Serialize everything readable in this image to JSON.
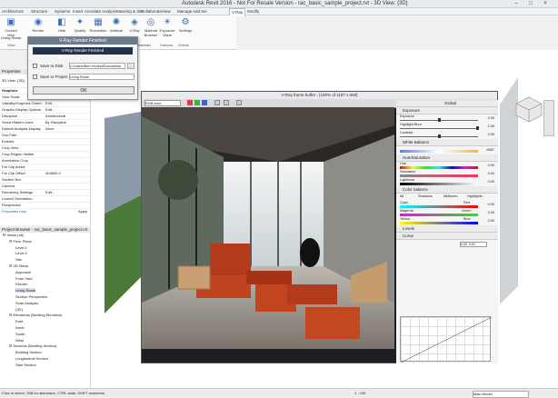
{
  "title": "Autodesk Revit 2016 - Not For Resale Version  -  rac_basic_sample_project.rvt - 3D View: {3D}",
  "tabs": [
    "Architecture",
    "Structure",
    "Systems",
    "Insert",
    "Annotate",
    "Analyze",
    "Massing & Site",
    "Collaborate",
    "View",
    "Manage",
    "Add-Ins",
    "V-Ray",
    "Modify"
  ],
  "active_tab": "V-Ray",
  "ribbon": {
    "buttons": [
      "Current View",
      "Render",
      "Hide",
      "Quality",
      "Resolution",
      "Artificial",
      "V-Ray",
      "Material Browser",
      "Exposure Value",
      "Settings"
    ],
    "panels": [
      "View",
      "Render",
      "Materials",
      "Camera",
      "Global"
    ],
    "view_value": "Living Room"
  },
  "dialog": {
    "title": "V-Ray Render Finished",
    "message": "V-Ray Render Finished",
    "save_to_disk": "Save to Disk",
    "save_to_disk_value": "C:\\Users\\Ben Hurlbut\\Documents",
    "save_to_project": "Save to Project",
    "save_to_project_value": "Living Room",
    "ok": "OK"
  },
  "properties": {
    "header": "Properties",
    "type": "3D View: {3D}",
    "edit_type": "Edit Type",
    "graphics": "Graphics",
    "rows": [
      {
        "k": "View Scale",
        "v": "1 : 100"
      },
      {
        "k": "Visibility/Graphics Overri...",
        "v": "Edit..."
      },
      {
        "k": "Graphic Display Options",
        "v": "Edit..."
      },
      {
        "k": "Discipline",
        "v": "Architectural"
      },
      {
        "k": "Show Hidden Lines",
        "v": "By Discipline"
      },
      {
        "k": "Default Analysis Display",
        "v": "None"
      },
      {
        "k": "Sun Path",
        "v": ""
      },
      {
        "k": "Extents",
        "v": ""
      },
      {
        "k": "Crop View",
        "v": ""
      },
      {
        "k": "Crop Region Visible",
        "v": ""
      },
      {
        "k": "Annotation Crop",
        "v": ""
      },
      {
        "k": "Far Clip Active",
        "v": ""
      },
      {
        "k": "Far Clip Offset",
        "v": "304800.0"
      },
      {
        "k": "Section Box",
        "v": ""
      },
      {
        "k": "Camera",
        "v": ""
      },
      {
        "k": "Rendering Settings",
        "v": "Edit..."
      },
      {
        "k": "Locked Orientation",
        "v": ""
      },
      {
        "k": "Perspective",
        "v": ""
      }
    ],
    "help": "Properties help",
    "apply": "Apply"
  },
  "project_browser": {
    "header": "Project Browser - rac_basic_sample_project.rvt",
    "items": [
      {
        "t": "Views (all)",
        "d": 0
      },
      {
        "t": "Floor Plans",
        "d": 1
      },
      {
        "t": "Level 1",
        "d": 2
      },
      {
        "t": "Level 2",
        "d": 2
      },
      {
        "t": "Site",
        "d": 2
      },
      {
        "t": "3D Views",
        "d": 1
      },
      {
        "t": "Approach",
        "d": 2
      },
      {
        "t": "From Yard",
        "d": 2
      },
      {
        "t": "Kitchen",
        "d": 2
      },
      {
        "t": "Living Room",
        "d": 2
      },
      {
        "t": "Section Perspective",
        "d": 2
      },
      {
        "t": "Solar Analysis",
        "d": 2
      },
      {
        "t": "{3D}",
        "d": 2
      },
      {
        "t": "Elevations (Building Elevation)",
        "d": 1
      },
      {
        "t": "East",
        "d": 2
      },
      {
        "t": "North",
        "d": 2
      },
      {
        "t": "South",
        "d": 2
      },
      {
        "t": "West",
        "d": 2
      },
      {
        "t": "Sections (Building Section)",
        "d": 1
      },
      {
        "t": "Building Section",
        "d": 2
      },
      {
        "t": "Longitudinal Section",
        "d": 2
      },
      {
        "t": "Stair Section",
        "d": 2
      }
    ]
  },
  "vfb": {
    "title": "V-Ray frame buffer - [100% of 1187 x 650]",
    "channel": "RGB color",
    "panel_header": "Global",
    "exposure": "Exposure",
    "exposure_value": "0.00",
    "highlight_burn": "Highlight Burn",
    "highlight_burn_value": "1.00",
    "contrast": "Contrast",
    "contrast_value": "0.00",
    "white_balance": "White Balance",
    "white_balance_value": "6867",
    "hue_saturation": "Hue/Saturation",
    "hue": "Hue",
    "hue_value": "0.00",
    "saturation": "Saturation",
    "saturation_value": "0.00",
    "lightness": "Lightness",
    "lightness_value": "0.00",
    "color_balance": "Color balance",
    "cb_options": [
      "All",
      "Shadows",
      "Midtones",
      "Highlights"
    ],
    "cyan": "Cyan",
    "red": "Red",
    "red_value": "0.00",
    "magenta": "Magenta",
    "green": "Green",
    "green_value": "0.00",
    "yellow": "Yellow",
    "blue": "Blue",
    "blue_value": "0.00",
    "levels": "Levels",
    "curve": "Curve",
    "curve_readout": "0.00, 0.00"
  },
  "status": {
    "left": "Click to select, TAB for alternates, CTRL adds, SHIFT unselects.",
    "scale": "1 : 100",
    "model": "Main Model"
  },
  "colors": {
    "accent": "#3b6fb6",
    "dialog_caption": "#6a7a8c",
    "dialog_banner": "#22324a"
  }
}
